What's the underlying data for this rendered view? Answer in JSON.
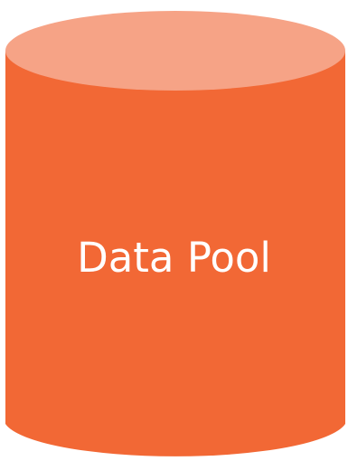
{
  "diagram": {
    "label": "Data Pool",
    "colors": {
      "body": "#f26835",
      "top": "#f6a386",
      "text": "#ffffff"
    }
  }
}
